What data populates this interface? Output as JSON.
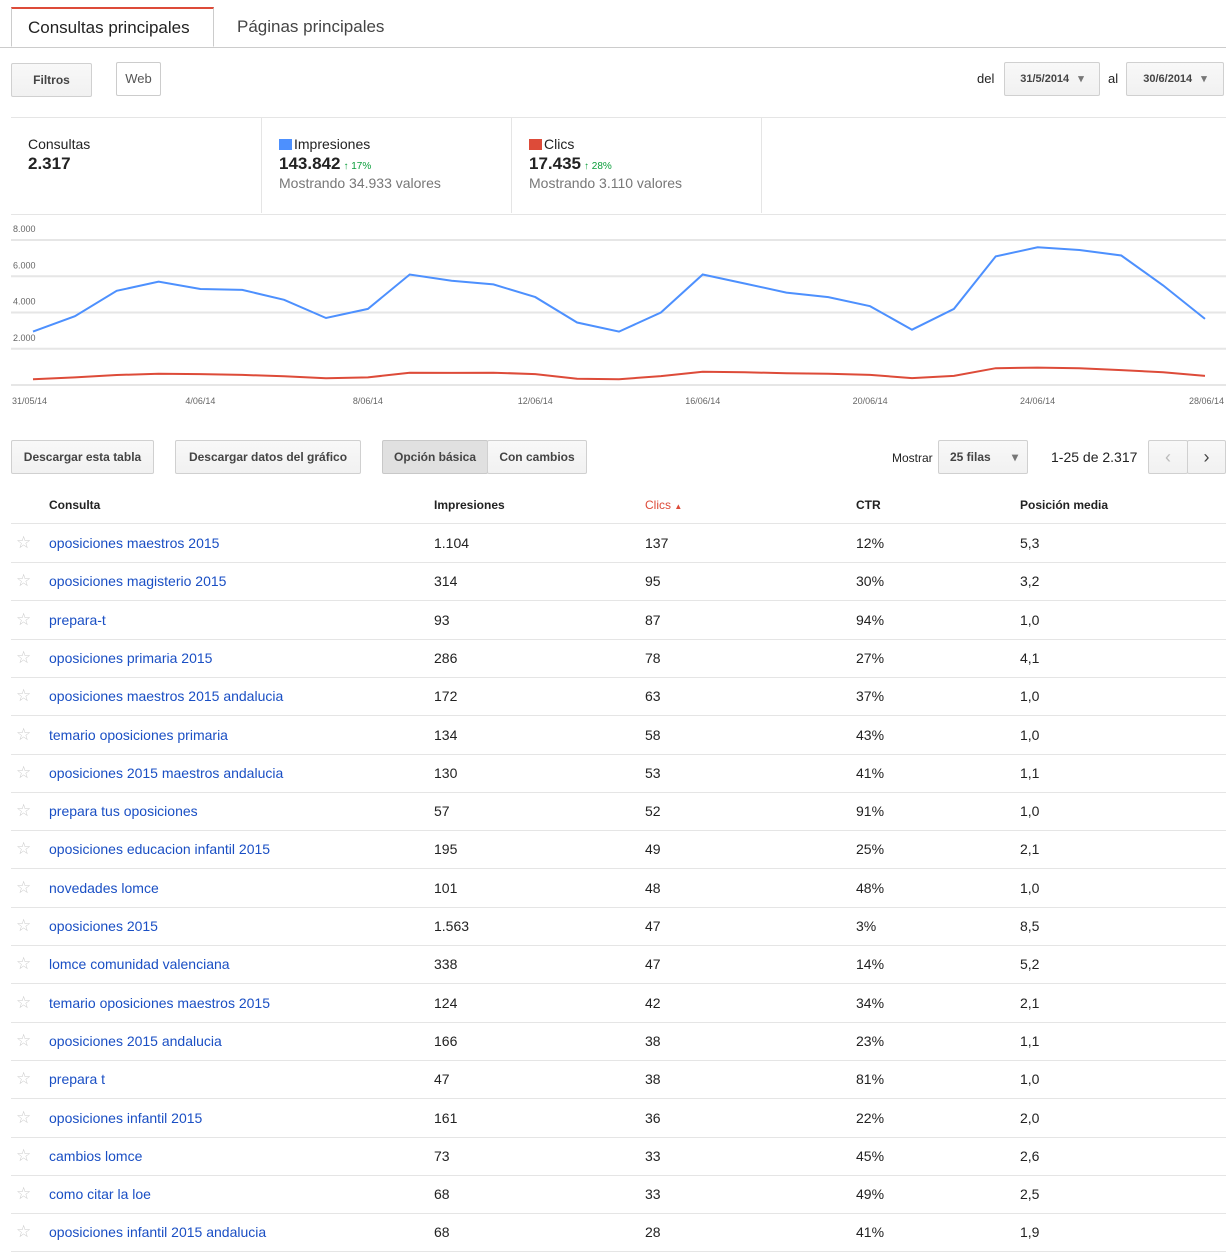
{
  "tabs": [
    {
      "label": "Consultas principales"
    },
    {
      "label": "Páginas principales"
    }
  ],
  "toolbar": {
    "filters_label": "Filtros",
    "web_label": "Web",
    "del_label": "del",
    "al_label": "al",
    "date_from": "31/5/2014",
    "date_to": "30/6/2014"
  },
  "stats": {
    "queries": {
      "label": "Consultas",
      "value": "2.317"
    },
    "impressions": {
      "label": "Impresiones",
      "value": "143.842",
      "delta": "17%",
      "sub": "Mostrando 34.933 valores",
      "color": "#4d90fe"
    },
    "clicks": {
      "label": "Clics",
      "value": "17.435",
      "delta": "28%",
      "sub": "Mostrando 3.110 valores",
      "color": "#dd4b39"
    }
  },
  "chart_data": {
    "type": "line",
    "y_tick_labels": [
      "8.000",
      "6.000",
      "4.000",
      "2.000"
    ],
    "yticks": [
      8000,
      6000,
      4000,
      2000
    ],
    "x_tick_labels": [
      "31/05/14",
      "4/06/14",
      "8/06/14",
      "12/06/14",
      "16/06/14",
      "20/06/14",
      "24/06/14",
      "28/06/14"
    ],
    "ylim": [
      0,
      8500
    ],
    "series": [
      {
        "name": "Impresiones",
        "color": "#4d90fe",
        "values": [
          2950,
          3800,
          5200,
          5700,
          5300,
          5250,
          4700,
          3700,
          4200,
          6100,
          5750,
          5550,
          4850,
          3450,
          2950,
          4000,
          6100,
          5600,
          5100,
          4850,
          4350,
          3050,
          4200,
          7100,
          7600,
          7450,
          7150,
          5500,
          3650
        ]
      },
      {
        "name": "Clics",
        "color": "#dd4b39",
        "values": [
          320,
          420,
          550,
          620,
          600,
          560,
          480,
          370,
          420,
          680,
          670,
          680,
          600,
          350,
          320,
          490,
          730,
          700,
          650,
          620,
          560,
          380,
          500,
          930,
          960,
          920,
          820,
          700,
          500
        ]
      }
    ]
  },
  "actions": {
    "download_table": "Descargar esta tabla",
    "download_chart": "Descargar datos del gráfico",
    "basic": "Opción básica",
    "changes": "Con cambios",
    "show_label": "Mostrar",
    "rows_select": "25 filas",
    "pagination": "1-25 de 2.317"
  },
  "table": {
    "headers": {
      "query": "Consulta",
      "impressions": "Impresiones",
      "clicks": "Clics",
      "ctr": "CTR",
      "position": "Posición media"
    },
    "sort_color": "#dd4b39",
    "rows": [
      {
        "query": "oposiciones maestros 2015",
        "impressions": "1.104",
        "clicks": "137",
        "ctr": "12%",
        "position": "5,3"
      },
      {
        "query": "oposiciones magisterio 2015",
        "impressions": "314",
        "clicks": "95",
        "ctr": "30%",
        "position": "3,2"
      },
      {
        "query": "prepara-t",
        "impressions": "93",
        "clicks": "87",
        "ctr": "94%",
        "position": "1,0"
      },
      {
        "query": "oposiciones primaria 2015",
        "impressions": "286",
        "clicks": "78",
        "ctr": "27%",
        "position": "4,1"
      },
      {
        "query": "oposiciones maestros 2015 andalucia",
        "impressions": "172",
        "clicks": "63",
        "ctr": "37%",
        "position": "1,0"
      },
      {
        "query": "temario oposiciones primaria",
        "impressions": "134",
        "clicks": "58",
        "ctr": "43%",
        "position": "1,0"
      },
      {
        "query": "oposiciones 2015 maestros andalucia",
        "impressions": "130",
        "clicks": "53",
        "ctr": "41%",
        "position": "1,1"
      },
      {
        "query": "prepara tus oposiciones",
        "impressions": "57",
        "clicks": "52",
        "ctr": "91%",
        "position": "1,0"
      },
      {
        "query": "oposiciones educacion infantil 2015",
        "impressions": "195",
        "clicks": "49",
        "ctr": "25%",
        "position": "2,1"
      },
      {
        "query": "novedades lomce",
        "impressions": "101",
        "clicks": "48",
        "ctr": "48%",
        "position": "1,0"
      },
      {
        "query": "oposiciones 2015",
        "impressions": "1.563",
        "clicks": "47",
        "ctr": "3%",
        "position": "8,5"
      },
      {
        "query": "lomce comunidad valenciana",
        "impressions": "338",
        "clicks": "47",
        "ctr": "14%",
        "position": "5,2"
      },
      {
        "query": "temario oposiciones maestros 2015",
        "impressions": "124",
        "clicks": "42",
        "ctr": "34%",
        "position": "2,1"
      },
      {
        "query": "oposiciones 2015 andalucia",
        "impressions": "166",
        "clicks": "38",
        "ctr": "23%",
        "position": "1,1"
      },
      {
        "query": "prepara t",
        "impressions": "47",
        "clicks": "38",
        "ctr": "81%",
        "position": "1,0"
      },
      {
        "query": "oposiciones infantil 2015",
        "impressions": "161",
        "clicks": "36",
        "ctr": "22%",
        "position": "2,0"
      },
      {
        "query": "cambios lomce",
        "impressions": "73",
        "clicks": "33",
        "ctr": "45%",
        "position": "2,6"
      },
      {
        "query": "como citar la loe",
        "impressions": "68",
        "clicks": "33",
        "ctr": "49%",
        "position": "2,5"
      },
      {
        "query": "oposiciones infantil 2015 andalucia",
        "impressions": "68",
        "clicks": "28",
        "ctr": "41%",
        "position": "1,9"
      }
    ]
  }
}
